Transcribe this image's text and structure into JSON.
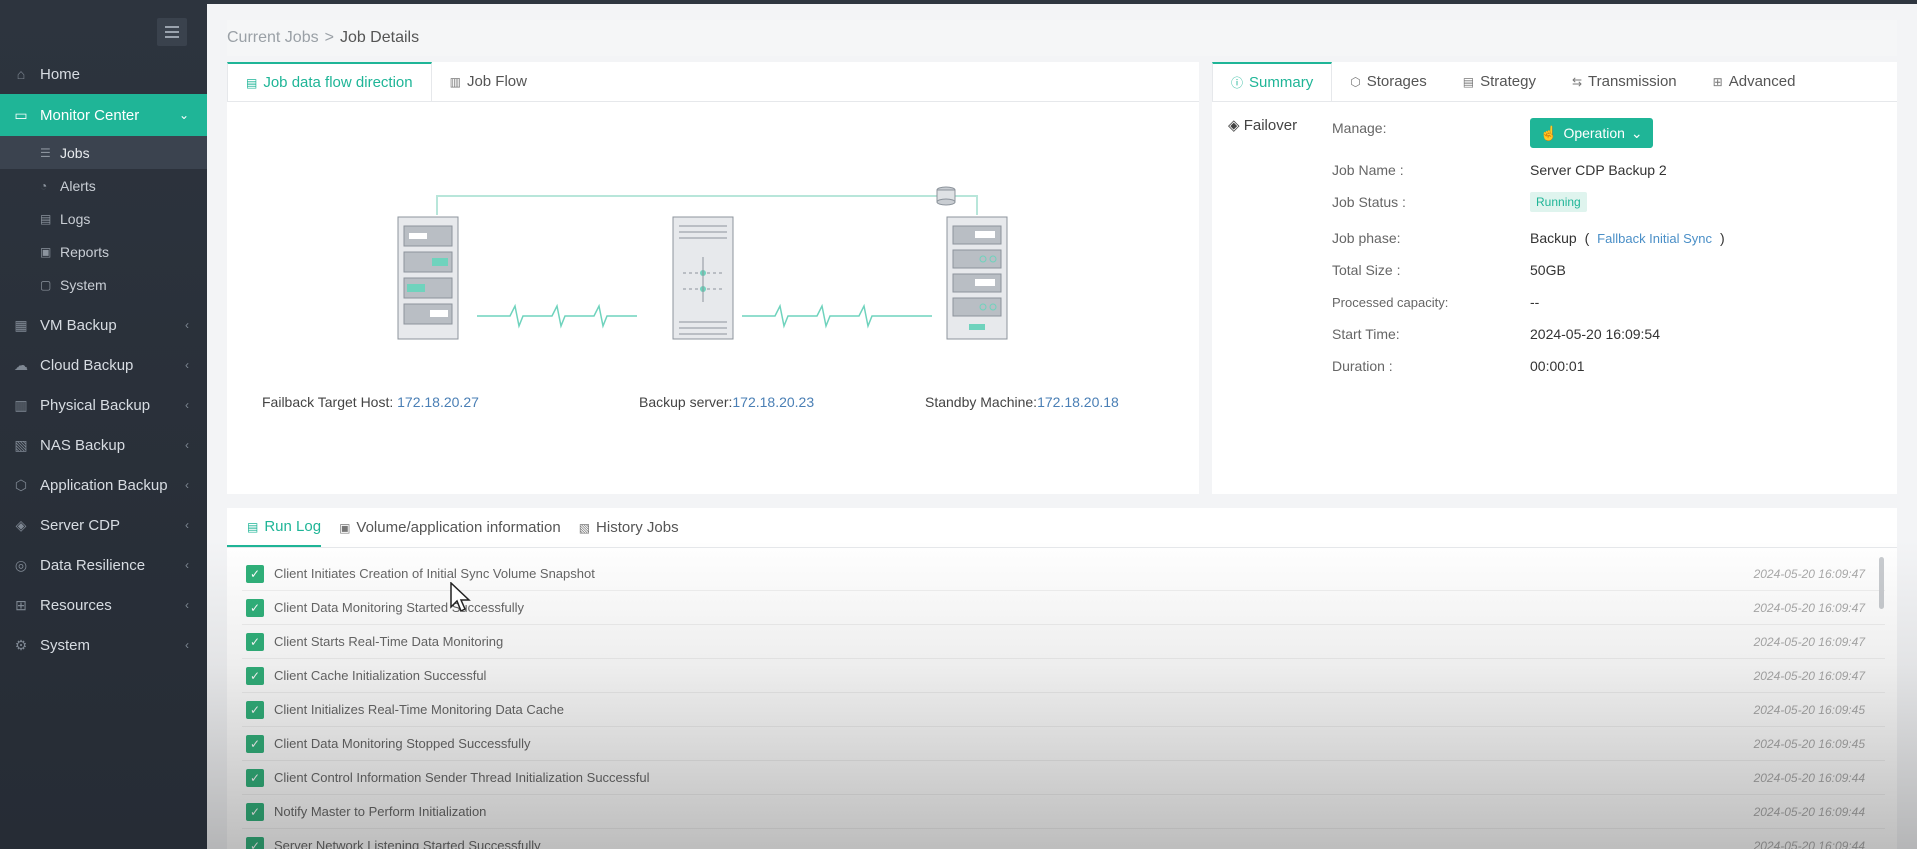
{
  "sidebar": {
    "items": [
      {
        "label": "Home",
        "icon": "home-icon"
      },
      {
        "label": "Monitor Center",
        "icon": "monitor-icon",
        "active": true
      },
      {
        "label": "VM Backup",
        "icon": "vm-icon"
      },
      {
        "label": "Cloud Backup",
        "icon": "cloud-icon"
      },
      {
        "label": "Physical Backup",
        "icon": "server-icon"
      },
      {
        "label": "NAS Backup",
        "icon": "nas-icon"
      },
      {
        "label": "Application Backup",
        "icon": "app-icon"
      },
      {
        "label": "Server CDP",
        "icon": "cdp-icon"
      },
      {
        "label": "Data Resilience",
        "icon": "resilience-icon"
      },
      {
        "label": "Resources",
        "icon": "grid-icon"
      },
      {
        "label": "System",
        "icon": "gear-icon"
      }
    ],
    "sub_items": [
      {
        "label": "Jobs",
        "icon": "list-icon"
      },
      {
        "label": "Alerts",
        "icon": "bell-icon"
      },
      {
        "label": "Logs",
        "icon": "log-icon"
      },
      {
        "label": "Reports",
        "icon": "report-icon"
      },
      {
        "label": "System",
        "icon": "system-icon"
      }
    ]
  },
  "breadcrumb": {
    "parent": "Current Jobs",
    "separator": ">",
    "current": "Job Details"
  },
  "left_tabs": [
    {
      "label": "Job data flow direction",
      "icon": "doc-icon"
    },
    {
      "label": "Job Flow",
      "icon": "chart-icon"
    }
  ],
  "diagram": {
    "hosts": [
      {
        "label": "Failback Target Host: ",
        "ip": "172.18.20.27"
      },
      {
        "label": "Backup server:",
        "ip": "172.18.20.23"
      },
      {
        "label": "Standby Machine:",
        "ip": "172.18.20.18"
      }
    ]
  },
  "right_tabs": [
    {
      "label": "Summary",
      "icon": "info-icon"
    },
    {
      "label": "Storages",
      "icon": "box-icon"
    },
    {
      "label": "Strategy",
      "icon": "strategy-icon"
    },
    {
      "label": "Transmission",
      "icon": "transfer-icon"
    },
    {
      "label": "Advanced",
      "icon": "grid-icon"
    }
  ],
  "summary": {
    "failover": "Failover",
    "manage_label": "Manage:",
    "operation_button": "Operation",
    "job_name_label": "Job Name :",
    "job_name": "Server CDP Backup 2",
    "job_status_label": "Job Status :",
    "job_status": "Running",
    "job_phase_label": "Job phase:",
    "job_phase": "Backup",
    "job_phase_open": "(",
    "job_phase_detail": "Fallback Initial Sync",
    "job_phase_close": ")",
    "total_size_label": "Total Size :",
    "total_size": "50GB",
    "processed_label": "Processed capacity:",
    "processed": "--",
    "start_time_label": "Start Time:",
    "start_time": "2024-05-20 16:09:54",
    "duration_label": "Duration :",
    "duration": "00:00:01"
  },
  "bottom_tabs": [
    {
      "label": "Run Log",
      "icon": "doc-icon"
    },
    {
      "label": "Volume/application information",
      "icon": "disk-icon"
    },
    {
      "label": "History Jobs",
      "icon": "history-icon"
    }
  ],
  "run_log": [
    {
      "text": "Client Initiates Creation of Initial Sync Volume Snapshot",
      "time": "2024-05-20 16:09:47"
    },
    {
      "text": "Client Data Monitoring Started Successfully",
      "time": "2024-05-20 16:09:47"
    },
    {
      "text": "Client Starts Real-Time Data Monitoring",
      "time": "2024-05-20 16:09:47"
    },
    {
      "text": "Client Cache Initialization Successful",
      "time": "2024-05-20 16:09:47"
    },
    {
      "text": "Client Initializes Real-Time Monitoring Data Cache",
      "time": "2024-05-20 16:09:45"
    },
    {
      "text": "Client Data Monitoring Stopped Successfully",
      "time": "2024-05-20 16:09:45"
    },
    {
      "text": "Client Control Information Sender Thread Initialization Successful",
      "time": "2024-05-20 16:09:44"
    },
    {
      "text": "Notify Master to Perform Initialization",
      "time": "2024-05-20 16:09:44"
    },
    {
      "text": "Server Network Listening Started Successfully",
      "time": "2024-05-20 16:09:44"
    }
  ],
  "colors": {
    "accent": "#1fb597",
    "sidebar": "#2d343e",
    "link": "#4a8fc7"
  }
}
